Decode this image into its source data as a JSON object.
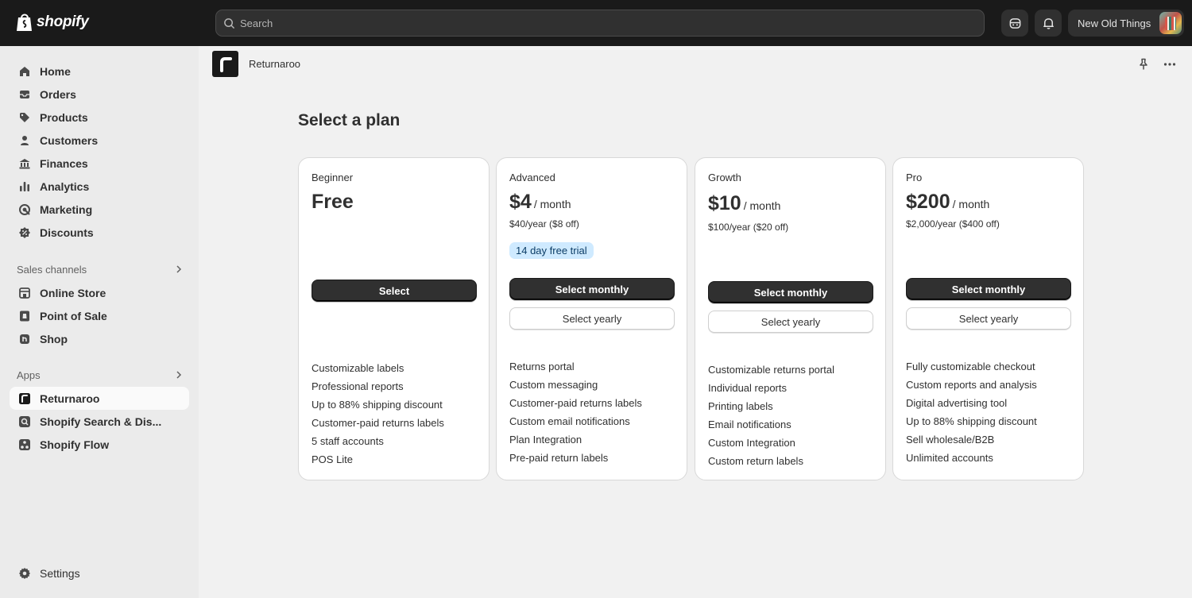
{
  "topbar": {
    "logo_text": "shopify",
    "search_placeholder": "Search",
    "store_name": "New Old Things"
  },
  "sidebar": {
    "items": [
      {
        "label": "Home",
        "icon": "home-icon"
      },
      {
        "label": "Orders",
        "icon": "inbox-icon"
      },
      {
        "label": "Products",
        "icon": "tag-icon"
      },
      {
        "label": "Customers",
        "icon": "person-icon"
      },
      {
        "label": "Finances",
        "icon": "bank-icon"
      },
      {
        "label": "Analytics",
        "icon": "bar-chart-icon"
      },
      {
        "label": "Marketing",
        "icon": "target-icon"
      },
      {
        "label": "Discounts",
        "icon": "discount-icon"
      }
    ],
    "sales_channels": {
      "label": "Sales channels",
      "items": [
        {
          "label": "Online Store",
          "icon": "store-icon"
        },
        {
          "label": "Point of Sale",
          "icon": "pos-icon"
        },
        {
          "label": "Shop",
          "icon": "shop-icon"
        }
      ]
    },
    "apps": {
      "label": "Apps",
      "items": [
        {
          "label": "Returnaroo",
          "icon": "returnaroo-icon",
          "active": true
        },
        {
          "label": "Shopify Search & Dis...",
          "icon": "search-app-icon"
        },
        {
          "label": "Shopify Flow",
          "icon": "flow-icon"
        }
      ]
    },
    "settings_label": "Settings"
  },
  "app": {
    "name": "Returnaroo"
  },
  "page": {
    "title": "Select a plan"
  },
  "plans": [
    {
      "name": "Beginner",
      "price": "Free",
      "per": "",
      "yearly": "",
      "badge": "",
      "primary_button": "Select",
      "secondary_button": "",
      "features": [
        "Customizable labels",
        "Professional reports",
        "Up to 88% shipping discount",
        "Customer-paid returns labels",
        "5 staff accounts",
        "POS Lite"
      ]
    },
    {
      "name": "Advanced",
      "price": "$4",
      "per": "/ month",
      "yearly": "$40/year ($8 off)",
      "badge": "14 day free trial",
      "primary_button": "Select monthly",
      "secondary_button": "Select yearly",
      "features": [
        "Returns portal",
        "Custom messaging",
        "Customer-paid returns labels",
        "Custom email notifications",
        "Plan Integration",
        "Pre-paid return labels"
      ]
    },
    {
      "name": "Growth",
      "price": "$10",
      "per": "/ month",
      "yearly": "$100/year ($20 off)",
      "badge": "",
      "primary_button": "Select monthly",
      "secondary_button": "Select yearly",
      "features": [
        "Customizable returns portal",
        "Individual reports",
        "Printing labels",
        "Email notifications",
        "Custom Integration",
        "Custom return labels"
      ]
    },
    {
      "name": "Pro",
      "price": "$200",
      "per": "/ month",
      "yearly": "$2,000/year ($400 off)",
      "badge": "",
      "primary_button": "Select monthly",
      "secondary_button": "Select yearly",
      "features": [
        "Fully customizable checkout",
        "Custom reports and analysis",
        "Digital advertising tool",
        "Up to 88% shipping discount",
        "Sell wholesale/B2B",
        "Unlimited accounts"
      ]
    }
  ],
  "colors": {
    "topbar_bg": "#1a1a1a",
    "sidebar_bg": "#ebebeb",
    "main_bg": "#f1f1f1",
    "primary_button": "#303030",
    "badge_bg": "#cfeaff"
  }
}
